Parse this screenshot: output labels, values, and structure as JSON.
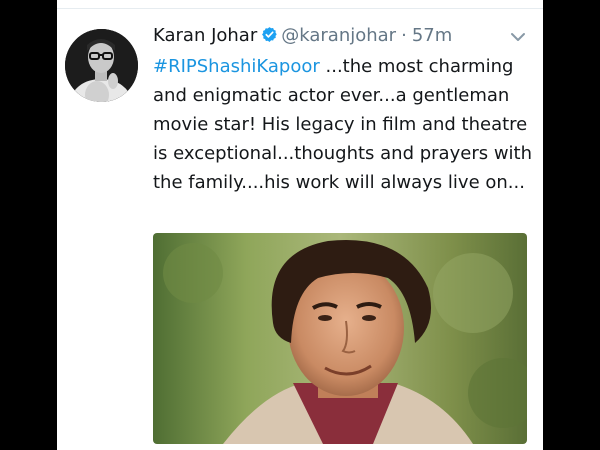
{
  "tweet": {
    "display_name": "Karan Johar",
    "handle": "@karanjohar",
    "separator": "·",
    "time": "57m",
    "hashtag": "#RIPShashiKapoor",
    "body": " ...the most charming and enigmatic actor ever...a gentleman movie star! His legacy in film and theatre is exceptional...thoughts and prayers with the family....his work will always live on...",
    "verified": true
  },
  "icons": {
    "verified": "verified-badge-icon",
    "caret": "chevron-down-icon"
  },
  "colors": {
    "hashtag": "#1b95e0",
    "verified": "#1da1f2",
    "secondary_text": "#657786",
    "primary_text": "#14171a",
    "background": "#ffffff",
    "page_background": "#000000"
  }
}
